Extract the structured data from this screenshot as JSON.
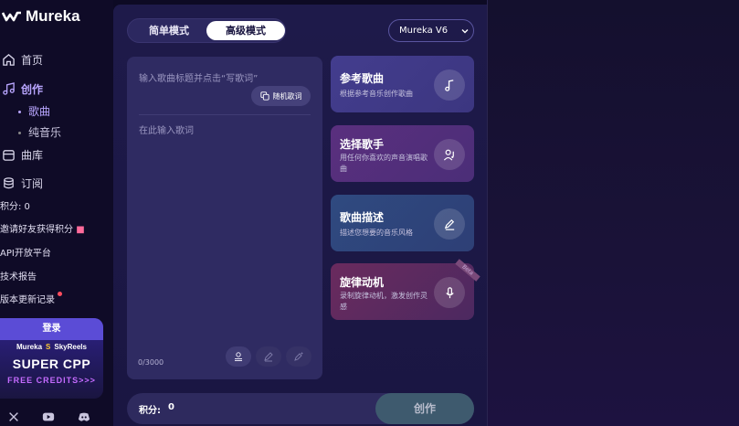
{
  "app": {
    "logo_text": "Mureka"
  },
  "sidebar": {
    "nav": [
      {
        "label": "首页",
        "icon": "home-icon"
      },
      {
        "label": "创作",
        "icon": "music-note-icon"
      },
      {
        "label": "曲库",
        "icon": "library-icon"
      },
      {
        "label": "订阅",
        "icon": "subscription-icon"
      }
    ],
    "sub_items": [
      {
        "label": "歌曲"
      },
      {
        "label": "纯音乐"
      }
    ],
    "credits_text": "积分: 0",
    "invite_text": "邀请好友获得积分",
    "api_text": "API开放平台",
    "tech_report": "技术报告",
    "changelog": "版本更新记录",
    "promo": {
      "top_label": "登录",
      "brand_a": "Mureka",
      "brand_b": "SkyReels",
      "headline": "SUPER CPP",
      "subline": "FREE CREDITS>>>"
    },
    "social_icons": [
      "x-icon",
      "youtube-icon",
      "discord-icon"
    ]
  },
  "main": {
    "mode_simple": "简单模式",
    "mode_advanced": "高级模式",
    "version": "Mureka V6",
    "title_placeholder": "输入歌曲标题并点击“写歌词”",
    "random_button": "随机歌词",
    "lyrics_placeholder": "在此输入歌词",
    "counter": "0/3000",
    "cards": [
      {
        "title": "参考歌曲",
        "desc": "根据参考音乐创作歌曲",
        "icon": "music-note-icon"
      },
      {
        "title": "选择歌手",
        "desc": "用任何你喜欢的声音演唱歌曲",
        "icon": "singer-icon"
      },
      {
        "title": "歌曲描述",
        "desc": "描述您想要的音乐风格",
        "icon": "pencil-icon"
      },
      {
        "title": "旋律动机",
        "desc": "录制旋律动机，激发创作灵感",
        "icon": "microphone-icon",
        "badge": "Beta"
      }
    ],
    "credits_label": "积分:",
    "credits_value": "0",
    "create_button": "创作"
  }
}
